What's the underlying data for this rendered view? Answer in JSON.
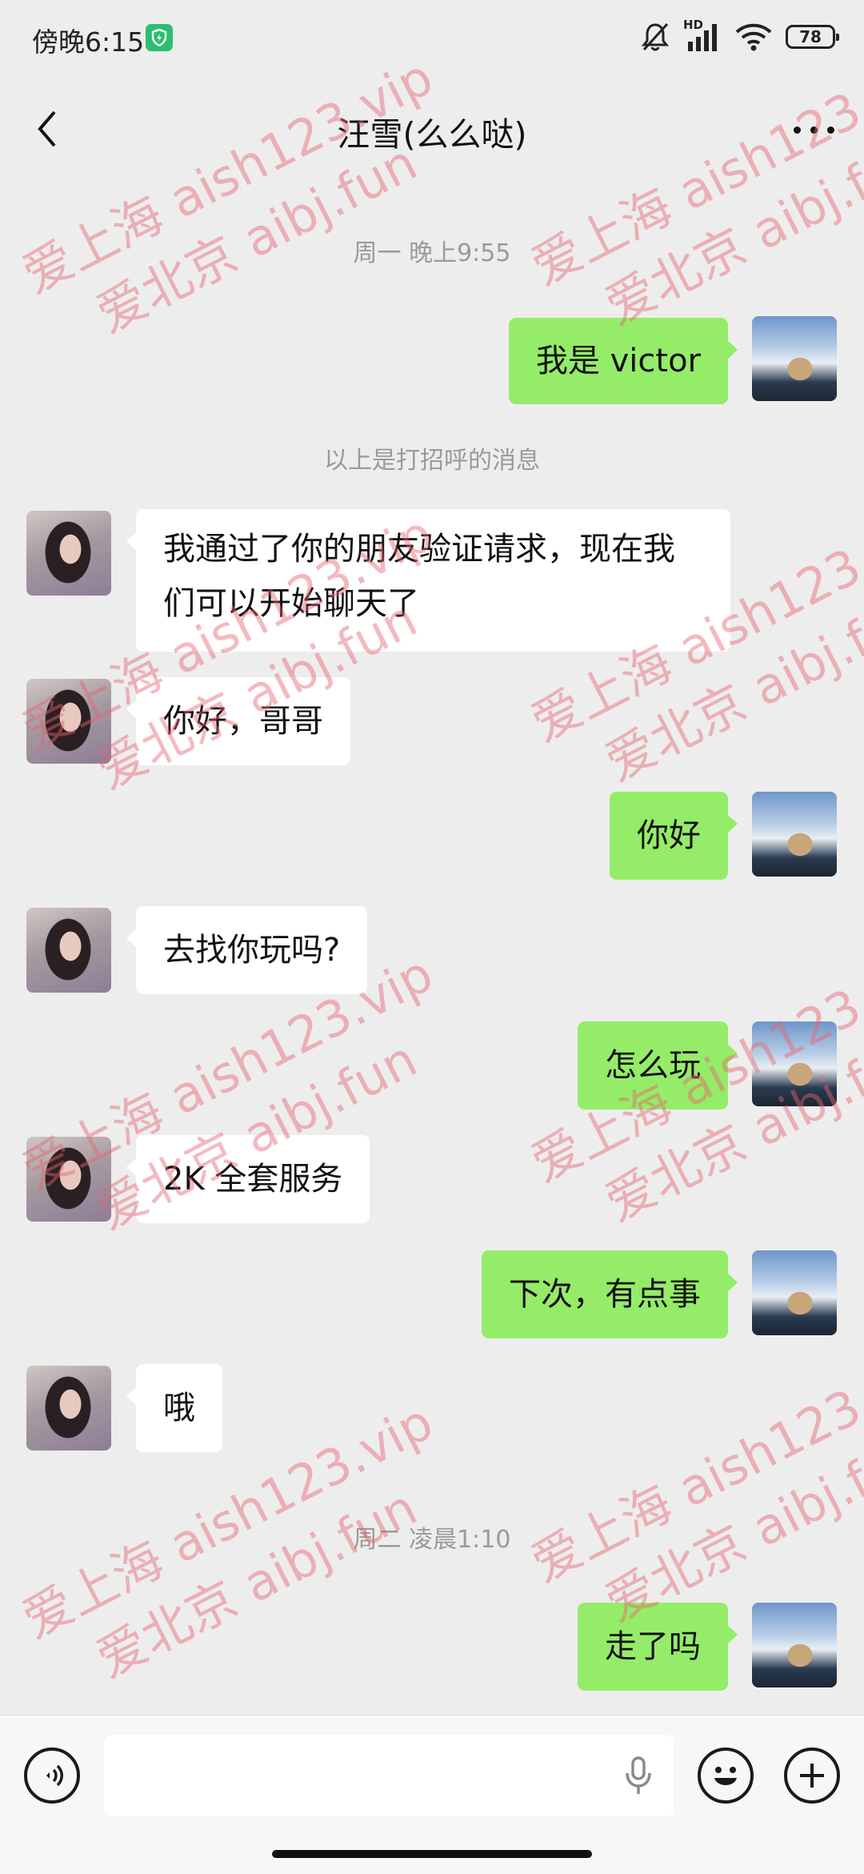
{
  "status_bar": {
    "time": "傍晚6:15",
    "network": "HD",
    "battery": "78"
  },
  "header": {
    "title": "汪雪(么么哒)"
  },
  "messages": [
    {
      "type": "time",
      "text": "周一 晚上9:55"
    },
    {
      "type": "sent",
      "text": "我是 victor"
    },
    {
      "type": "system",
      "text": "以上是打招呼的消息"
    },
    {
      "type": "received",
      "text": "我通过了你的朋友验证请求，现在我们可以开始聊天了"
    },
    {
      "type": "received",
      "text": "你好，哥哥"
    },
    {
      "type": "sent",
      "text": "你好"
    },
    {
      "type": "received",
      "text": "去找你玩吗?"
    },
    {
      "type": "sent",
      "text": "怎么玩"
    },
    {
      "type": "received",
      "text": "2K 全套服务"
    },
    {
      "type": "sent",
      "text": "下次，有点事"
    },
    {
      "type": "received",
      "text": "哦"
    },
    {
      "type": "time",
      "text": "周二 凌晨1:10"
    },
    {
      "type": "sent",
      "text": "走了吗"
    }
  ],
  "watermark": {
    "line1": "爱上海 aish123.vip",
    "line2": "爱北京 aibj.fun",
    "color": "#e6646e"
  },
  "colors": {
    "sent_bubble": "#95ec69",
    "received_bubble": "#ffffff",
    "background": "#ededed"
  },
  "icons": {
    "back": "back-chevron-icon",
    "more": "more-dots-icon",
    "voice": "voice-icon",
    "mic": "microphone-icon",
    "emoji": "emoji-icon",
    "add": "plus-icon"
  }
}
